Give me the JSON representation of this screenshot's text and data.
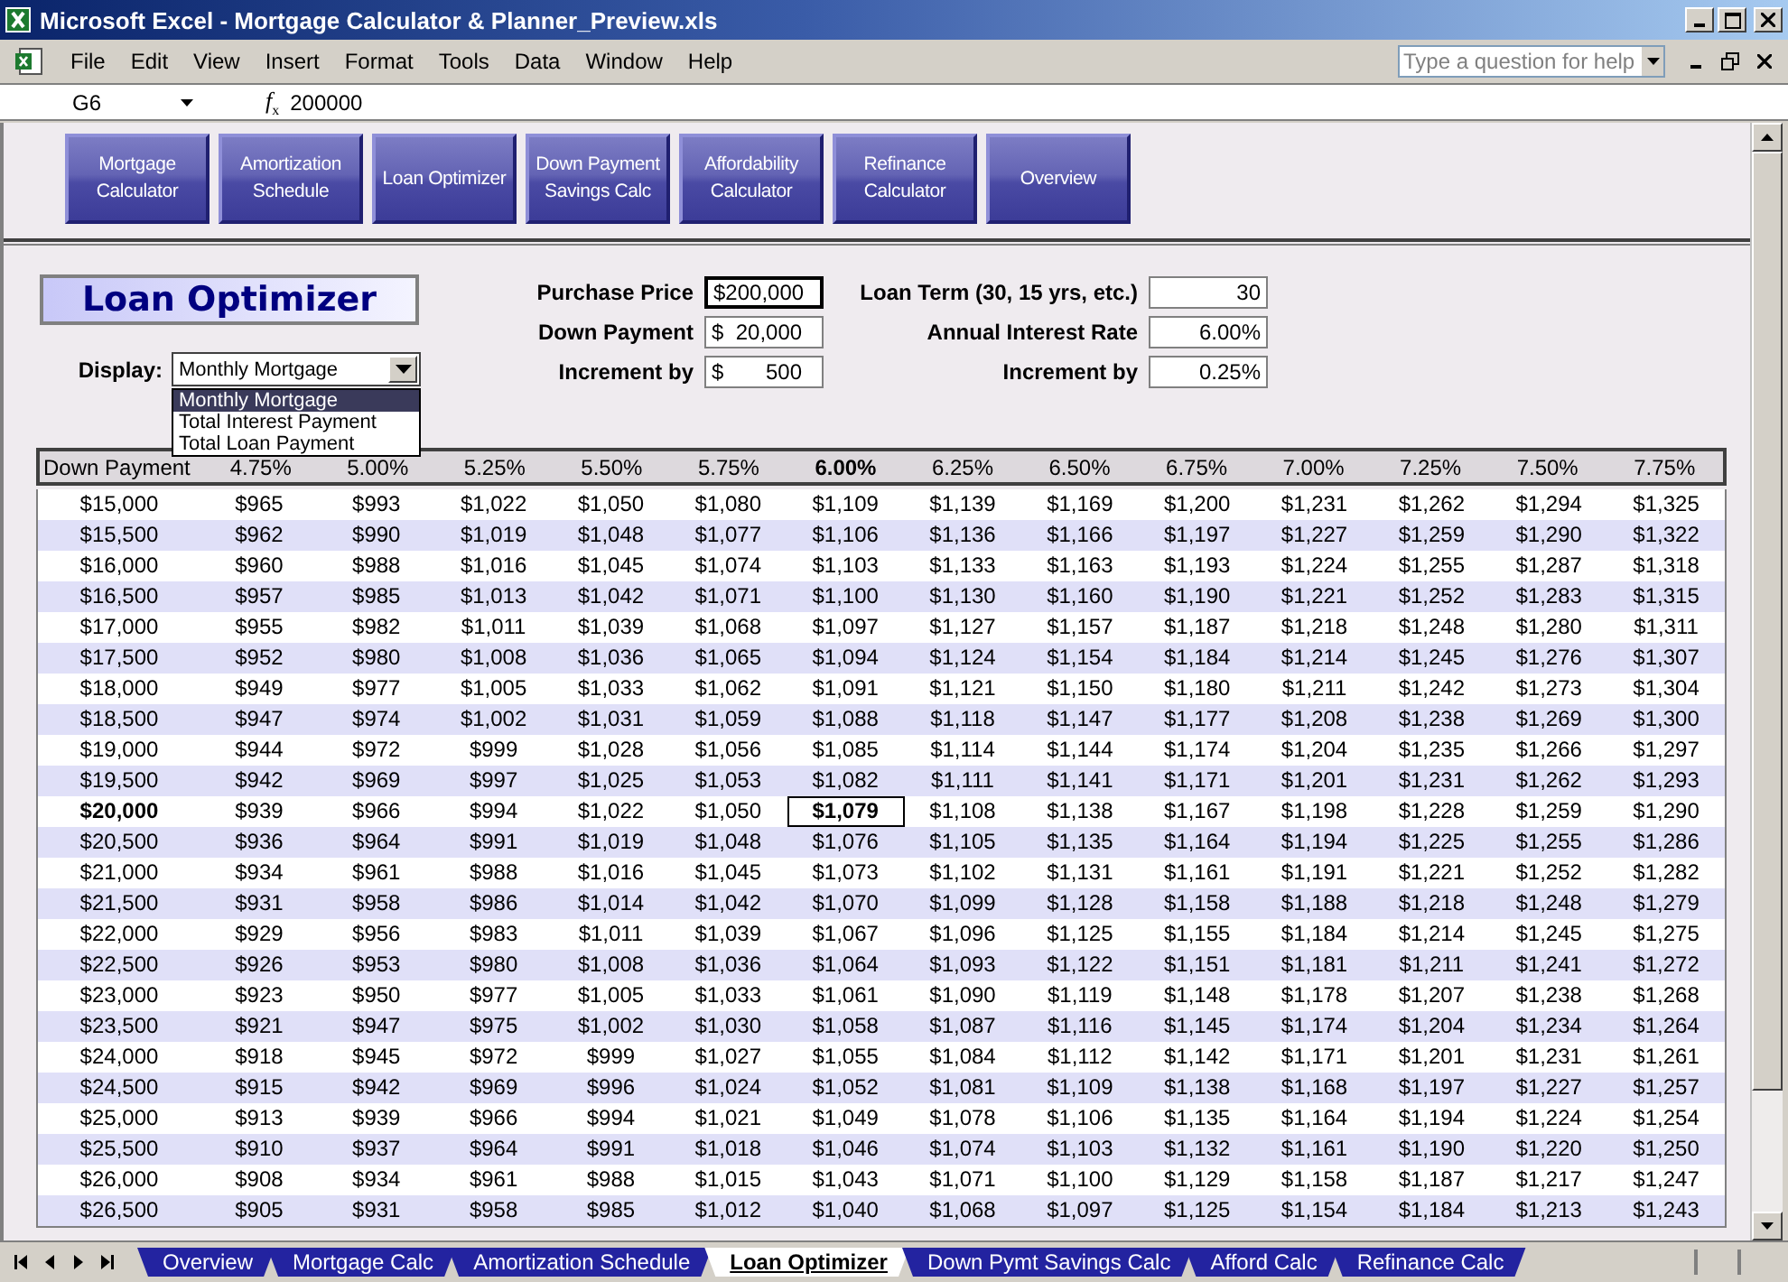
{
  "window": {
    "title": "Microsoft Excel - Mortgage Calculator & Planner_Preview.xls"
  },
  "menu": [
    "File",
    "Edit",
    "View",
    "Insert",
    "Format",
    "Tools",
    "Data",
    "Window",
    "Help"
  ],
  "help_box": {
    "placeholder": "Type a question for help"
  },
  "name_box": "G6",
  "formula_label": "*f*$_{x}$",
  "formula": "200000",
  "nav_buttons": [
    {
      "label": "Mortgage Calculator"
    },
    {
      "label": "Amortization Schedule"
    },
    {
      "label": "Loan Optimizer"
    },
    {
      "label": "Down Payment Savings Calc"
    },
    {
      "label": "Affordability Calculator"
    },
    {
      "label": "Refinance Calculator"
    },
    {
      "label": "Overview"
    }
  ],
  "sheet_title": "Loan Optimizer",
  "display": {
    "label": "Display:",
    "value": "Monthly Mortgage",
    "options": [
      {
        "label": "Monthly Mortgage",
        "selected": true
      },
      {
        "label": "Total Interest Payment",
        "selected": false
      },
      {
        "label": "Total Loan Payment",
        "selected": false
      }
    ]
  },
  "left_inputs": [
    {
      "label": "Purchase Price",
      "value": "$200,000",
      "selected": true
    },
    {
      "label": "Down Payment",
      "value": "$  20,000",
      "selected": false
    },
    {
      "label": "Increment by",
      "value": "$       500",
      "selected": false
    }
  ],
  "right_inputs": [
    {
      "label": "Loan Term (30, 15 yrs, etc.)",
      "value": "30"
    },
    {
      "label": "Annual Interest Rate",
      "value": "6.00%"
    },
    {
      "label": "Increment by",
      "value": "0.25%"
    }
  ],
  "table": {
    "columns": [
      {
        "label": "Down Payment",
        "selected": false
      },
      {
        "label": "4.75%",
        "selected": false
      },
      {
        "label": "5.00%",
        "selected": false
      },
      {
        "label": "5.25%",
        "selected": false
      },
      {
        "label": "5.50%",
        "selected": false
      },
      {
        "label": "5.75%",
        "selected": false
      },
      {
        "label": "6.00%",
        "selected": true
      },
      {
        "label": "6.25%",
        "selected": false
      },
      {
        "label": "6.50%",
        "selected": false
      },
      {
        "label": "6.75%",
        "selected": false
      },
      {
        "label": "7.00%",
        "selected": false
      },
      {
        "label": "7.25%",
        "selected": false
      },
      {
        "label": "7.50%",
        "selected": false
      },
      {
        "label": "7.75%",
        "selected": false
      }
    ],
    "rows": [
      {
        "selected": false,
        "cells": [
          "$15,000",
          "$965",
          "$993",
          "$1,022",
          "$1,050",
          "$1,080",
          "$1,109",
          "$1,139",
          "$1,169",
          "$1,200",
          "$1,231",
          "$1,262",
          "$1,294",
          "$1,325"
        ]
      },
      {
        "selected": false,
        "cells": [
          "$15,500",
          "$962",
          "$990",
          "$1,019",
          "$1,048",
          "$1,077",
          "$1,106",
          "$1,136",
          "$1,166",
          "$1,197",
          "$1,227",
          "$1,259",
          "$1,290",
          "$1,322"
        ]
      },
      {
        "selected": false,
        "cells": [
          "$16,000",
          "$960",
          "$988",
          "$1,016",
          "$1,045",
          "$1,074",
          "$1,103",
          "$1,133",
          "$1,163",
          "$1,193",
          "$1,224",
          "$1,255",
          "$1,287",
          "$1,318"
        ]
      },
      {
        "selected": false,
        "cells": [
          "$16,500",
          "$957",
          "$985",
          "$1,013",
          "$1,042",
          "$1,071",
          "$1,100",
          "$1,130",
          "$1,160",
          "$1,190",
          "$1,221",
          "$1,252",
          "$1,283",
          "$1,315"
        ]
      },
      {
        "selected": false,
        "cells": [
          "$17,000",
          "$955",
          "$982",
          "$1,011",
          "$1,039",
          "$1,068",
          "$1,097",
          "$1,127",
          "$1,157",
          "$1,187",
          "$1,218",
          "$1,248",
          "$1,280",
          "$1,311"
        ]
      },
      {
        "selected": false,
        "cells": [
          "$17,500",
          "$952",
          "$980",
          "$1,008",
          "$1,036",
          "$1,065",
          "$1,094",
          "$1,124",
          "$1,154",
          "$1,184",
          "$1,214",
          "$1,245",
          "$1,276",
          "$1,307"
        ]
      },
      {
        "selected": false,
        "cells": [
          "$18,000",
          "$949",
          "$977",
          "$1,005",
          "$1,033",
          "$1,062",
          "$1,091",
          "$1,121",
          "$1,150",
          "$1,180",
          "$1,211",
          "$1,242",
          "$1,273",
          "$1,304"
        ]
      },
      {
        "selected": false,
        "cells": [
          "$18,500",
          "$947",
          "$974",
          "$1,002",
          "$1,031",
          "$1,059",
          "$1,088",
          "$1,118",
          "$1,147",
          "$1,177",
          "$1,208",
          "$1,238",
          "$1,269",
          "$1,300"
        ]
      },
      {
        "selected": false,
        "cells": [
          "$19,000",
          "$944",
          "$972",
          "$999",
          "$1,028",
          "$1,056",
          "$1,085",
          "$1,114",
          "$1,144",
          "$1,174",
          "$1,204",
          "$1,235",
          "$1,266",
          "$1,297"
        ]
      },
      {
        "selected": false,
        "cells": [
          "$19,500",
          "$942",
          "$969",
          "$997",
          "$1,025",
          "$1,053",
          "$1,082",
          "$1,111",
          "$1,141",
          "$1,171",
          "$1,201",
          "$1,231",
          "$1,262",
          "$1,293"
        ]
      },
      {
        "selected": true,
        "cells": [
          "$20,000",
          "$939",
          "$966",
          "$994",
          "$1,022",
          "$1,050",
          "$1,079",
          "$1,108",
          "$1,138",
          "$1,167",
          "$1,198",
          "$1,228",
          "$1,259",
          "$1,290"
        ]
      },
      {
        "selected": false,
        "cells": [
          "$20,500",
          "$936",
          "$964",
          "$991",
          "$1,019",
          "$1,048",
          "$1,076",
          "$1,105",
          "$1,135",
          "$1,164",
          "$1,194",
          "$1,225",
          "$1,255",
          "$1,286"
        ]
      },
      {
        "selected": false,
        "cells": [
          "$21,000",
          "$934",
          "$961",
          "$988",
          "$1,016",
          "$1,045",
          "$1,073",
          "$1,102",
          "$1,131",
          "$1,161",
          "$1,191",
          "$1,221",
          "$1,252",
          "$1,282"
        ]
      },
      {
        "selected": false,
        "cells": [
          "$21,500",
          "$931",
          "$958",
          "$986",
          "$1,014",
          "$1,042",
          "$1,070",
          "$1,099",
          "$1,128",
          "$1,158",
          "$1,188",
          "$1,218",
          "$1,248",
          "$1,279"
        ]
      },
      {
        "selected": false,
        "cells": [
          "$22,000",
          "$929",
          "$956",
          "$983",
          "$1,011",
          "$1,039",
          "$1,067",
          "$1,096",
          "$1,125",
          "$1,155",
          "$1,184",
          "$1,214",
          "$1,245",
          "$1,275"
        ]
      },
      {
        "selected": false,
        "cells": [
          "$22,500",
          "$926",
          "$953",
          "$980",
          "$1,008",
          "$1,036",
          "$1,064",
          "$1,093",
          "$1,122",
          "$1,151",
          "$1,181",
          "$1,211",
          "$1,241",
          "$1,272"
        ]
      },
      {
        "selected": false,
        "cells": [
          "$23,000",
          "$923",
          "$950",
          "$977",
          "$1,005",
          "$1,033",
          "$1,061",
          "$1,090",
          "$1,119",
          "$1,148",
          "$1,178",
          "$1,207",
          "$1,238",
          "$1,268"
        ]
      },
      {
        "selected": false,
        "cells": [
          "$23,500",
          "$921",
          "$947",
          "$975",
          "$1,002",
          "$1,030",
          "$1,058",
          "$1,087",
          "$1,116",
          "$1,145",
          "$1,174",
          "$1,204",
          "$1,234",
          "$1,264"
        ]
      },
      {
        "selected": false,
        "cells": [
          "$24,000",
          "$918",
          "$945",
          "$972",
          "$999",
          "$1,027",
          "$1,055",
          "$1,084",
          "$1,112",
          "$1,142",
          "$1,171",
          "$1,201",
          "$1,231",
          "$1,261"
        ]
      },
      {
        "selected": false,
        "cells": [
          "$24,500",
          "$915",
          "$942",
          "$969",
          "$996",
          "$1,024",
          "$1,052",
          "$1,081",
          "$1,109",
          "$1,138",
          "$1,168",
          "$1,197",
          "$1,227",
          "$1,257"
        ]
      },
      {
        "selected": false,
        "cells": [
          "$25,000",
          "$913",
          "$939",
          "$966",
          "$994",
          "$1,021",
          "$1,049",
          "$1,078",
          "$1,106",
          "$1,135",
          "$1,164",
          "$1,194",
          "$1,224",
          "$1,254"
        ]
      },
      {
        "selected": false,
        "cells": [
          "$25,500",
          "$910",
          "$937",
          "$964",
          "$991",
          "$1,018",
          "$1,046",
          "$1,074",
          "$1,103",
          "$1,132",
          "$1,161",
          "$1,190",
          "$1,220",
          "$1,250"
        ]
      },
      {
        "selected": false,
        "cells": [
          "$26,000",
          "$908",
          "$934",
          "$961",
          "$988",
          "$1,015",
          "$1,043",
          "$1,071",
          "$1,100",
          "$1,129",
          "$1,158",
          "$1,187",
          "$1,217",
          "$1,247"
        ]
      },
      {
        "selected": false,
        "cells": [
          "$26,500",
          "$905",
          "$931",
          "$958",
          "$985",
          "$1,012",
          "$1,040",
          "$1,068",
          "$1,097",
          "$1,125",
          "$1,154",
          "$1,184",
          "$1,213",
          "$1,243"
        ]
      }
    ]
  },
  "sheet_tabs": [
    {
      "label": "Overview",
      "selected": false
    },
    {
      "label": "Mortgage Calc",
      "selected": false
    },
    {
      "label": "Amortization Schedule",
      "selected": false
    },
    {
      "label": "Loan Optimizer",
      "selected": true
    },
    {
      "label": "Down Pymt Savings Calc",
      "selected": false
    },
    {
      "label": "Afford Calc",
      "selected": false
    },
    {
      "label": "Refinance Calc",
      "selected": false
    }
  ]
}
